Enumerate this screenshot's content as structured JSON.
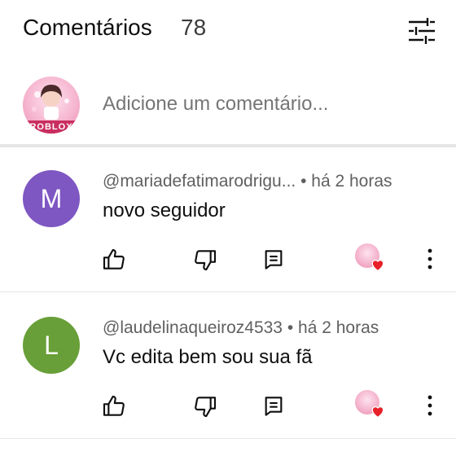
{
  "header": {
    "title": "Comentários",
    "count": "78",
    "filter_icon": "sliders-icon"
  },
  "add_comment": {
    "placeholder": "Adicione um comentário...",
    "avatar_badge": "ROBLOX"
  },
  "comments": [
    {
      "avatar_letter": "M",
      "avatar_color": "#7e57c2",
      "author": "@mariadefatimarodrigu...",
      "time": "há 2 horas",
      "text": "novo seguidor"
    },
    {
      "avatar_letter": "L",
      "avatar_color": "#689f38",
      "author": "@laudelinaqueiroz4533",
      "time": "há 2 horas",
      "text": "Vc edita bem sou sua fã"
    }
  ],
  "colors": {
    "heart": "#e8202a",
    "divider": "#e5e5e5",
    "meta_text": "#606060"
  }
}
